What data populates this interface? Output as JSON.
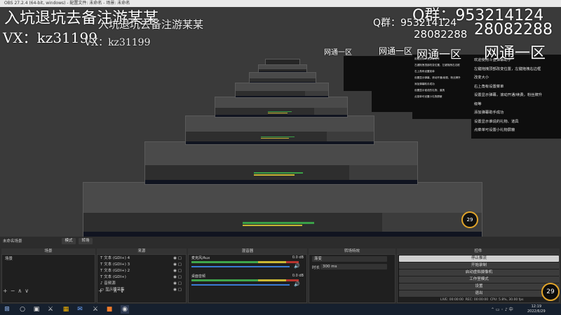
{
  "window": {
    "title": "OBS 27.2.4 (64-bit, windows) - 配置文件: 未命名 - 场景: 未命名"
  },
  "watermark": {
    "left_top": "入坑退坑去备注游某某",
    "left_wx": "VX：kz31199",
    "right_q": "Q群：953214124",
    "right_num": "28082288",
    "right_zone": "网通一区"
  },
  "overlay_text": [
    "欢迎使用斗鱼弹幕助手",
    "左键拖拽顶部改变位置，左键拖拽右边框",
    "改变大小",
    "右上角有设置菜单",
    "设置显示弹幕，滚动开通/续费，粉丝牌升",
    "级等",
    "添加弹幕助手成功",
    "设置显示谁说的礼物、道具",
    "点菜单可设置小礼物屏蔽"
  ],
  "docks": {
    "scene_tabs": [
      "未命名场景",
      "模式",
      "转场"
    ],
    "headers": {
      "scenes": "场景",
      "sources": "来源",
      "mixer": "混音器",
      "transitions": "转场特效",
      "controls": "控件"
    },
    "scenes": [
      "场景"
    ],
    "sources": [
      {
        "icon": "text-icon",
        "label": "文本 (GDI+) 4"
      },
      {
        "icon": "text-icon",
        "label": "文本 (GDI+) 3"
      },
      {
        "icon": "text-icon",
        "label": "文本 (GDI+) 2"
      },
      {
        "icon": "text-icon",
        "label": "文本 (GDI+)"
      },
      {
        "icon": "audio-icon",
        "label": "音频源"
      },
      {
        "icon": "monitor-icon",
        "label": "显示器采集"
      }
    ],
    "mixer": [
      {
        "name": "麦克风/Aux",
        "db": "0.0 dB"
      },
      {
        "name": "桌面音频",
        "db": "0.0 dB"
      }
    ],
    "transitions": {
      "type": "渐变",
      "duration_label": "时长",
      "duration_value": "300 ms"
    },
    "controls": [
      "停止推流",
      "开始录制",
      "启动虚拟摄像机",
      "工作室模式",
      "设置",
      "退出"
    ],
    "bottom_controls": [
      "+",
      "−",
      "∧",
      "∨"
    ]
  },
  "status": {
    "live": "LIVE: 00:00:00",
    "rec": "REC: 00:00:00",
    "cpu": "CPU: 5.8%, 30.00 fps"
  },
  "overlay_badge": "29",
  "taskbar": {
    "icons": [
      "windows-icon",
      "search-icon",
      "taskview-icon",
      "csgo-icon",
      "store-icon",
      "mail-icon",
      "csgo2-icon",
      "app-icon",
      "obs-icon"
    ],
    "time": "12:19",
    "date": "2022/6/29"
  }
}
